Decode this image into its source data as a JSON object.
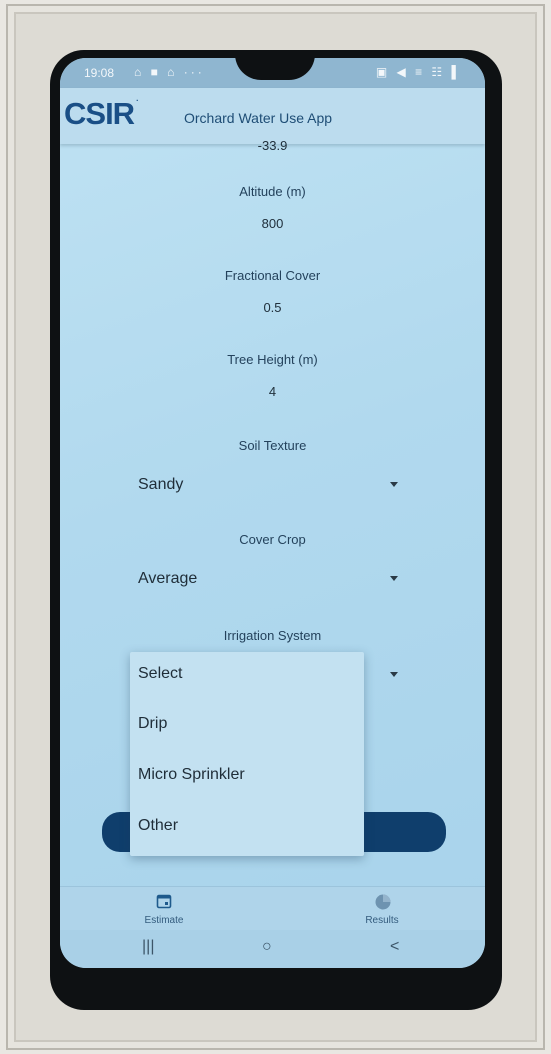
{
  "status_bar": {
    "time": "19:08",
    "left_icons": "⌂ ■ ⌂  ···",
    "right_icons": "▣ ◀ ≡ ☷ ▌"
  },
  "app_bar": {
    "logo": "CSIR",
    "logo_mark": "·",
    "title": "Orchard Water Use App"
  },
  "form": {
    "latitude_value": "-33.9",
    "altitude_label": "Altitude (m)",
    "altitude_value": "800",
    "fractional_cover_label": "Fractional Cover",
    "fractional_cover_value": "0.5",
    "tree_height_label": "Tree Height (m)",
    "tree_height_value": "4",
    "soil_texture_label": "Soil Texture",
    "soil_texture_value": "Sandy",
    "cover_crop_label": "Cover Crop",
    "cover_crop_value": "Average",
    "irrigation_label": "Irrigation System"
  },
  "dropdown": {
    "options": [
      "Select",
      "Drip",
      "Micro Sprinkler",
      "Other"
    ]
  },
  "bottom_nav": {
    "estimate_label": "Estimate",
    "results_label": "Results"
  },
  "system_nav": {
    "recents": "|||",
    "home": "○",
    "back": "<"
  },
  "colors": {
    "brand": "#1a4f86",
    "submit_button": "#0f3e6c",
    "screen_bg": "#b1d9ee"
  }
}
